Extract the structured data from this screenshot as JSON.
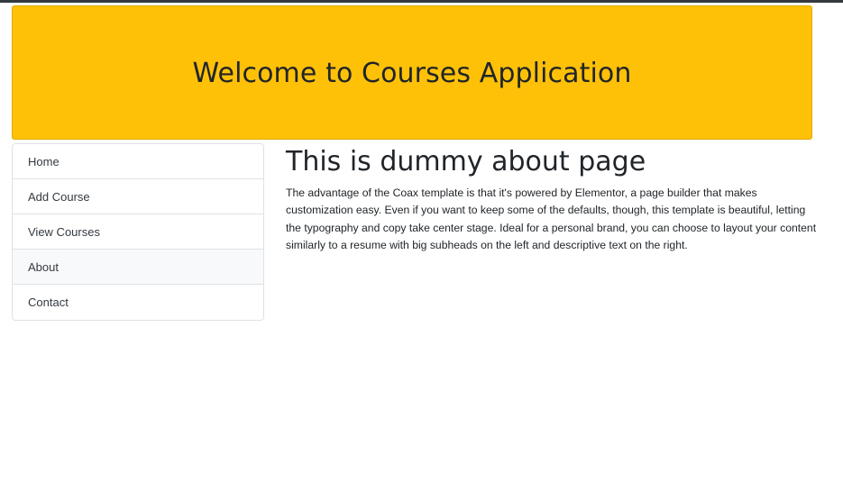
{
  "banner": {
    "title": "Welcome to Courses Application"
  },
  "menu": {
    "items": [
      {
        "label": "Home"
      },
      {
        "label": "Add Course"
      },
      {
        "label": "View Courses"
      },
      {
        "label": "About"
      },
      {
        "label": "Contact"
      }
    ],
    "active": "About"
  },
  "content": {
    "title": "This is dummy about page",
    "text": "The advantage of the Coax template is that it's powered by Elementor, a page builder that makes customization easy. Even if you want to keep some of the defaults, though, this template is beautiful, letting the typography and copy take center stage. Ideal for a personal brand, you can choose to layout your content similarly to a resume with big subheads on the left and descriptive text on the right."
  },
  "colors": {
    "banner_bg": "#ffc107",
    "text": "#212529",
    "active_item_bg": "#f8f9fa",
    "border": "#dee2e6"
  }
}
